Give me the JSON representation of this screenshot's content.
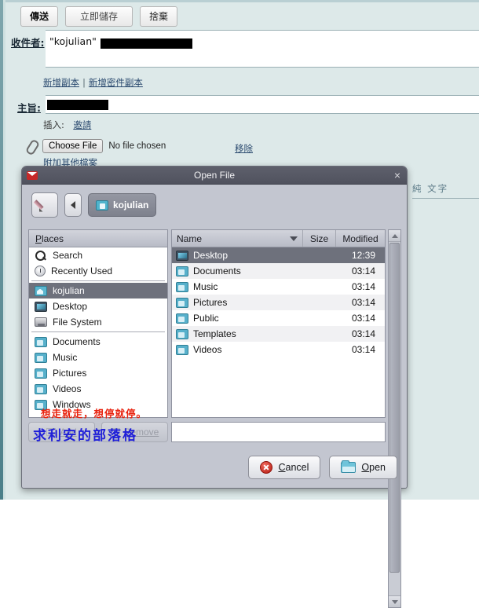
{
  "compose": {
    "toolbar": {
      "send_label": "傳送",
      "save_label": "立即儲存",
      "discard_label": "捨棄"
    },
    "to": {
      "label": "收件者:",
      "value": "\"kojulian\""
    },
    "cc_links": {
      "add_cc": "新增副本",
      "separator": "|",
      "add_bcc": "新增密件副本"
    },
    "subject": {
      "label": "主旨:",
      "value": ""
    },
    "insert": {
      "label": "插入:",
      "invite_link": "邀請"
    },
    "attachment": {
      "choose_button": "Choose File",
      "status": "No file chosen",
      "remove_link": "移除",
      "attach_more_link": "附加其他檔案"
    },
    "plain_text_link": "純 文字"
  },
  "dialog": {
    "title": "Open File",
    "close_label": "×",
    "nav": {
      "edit_icon": "pencil-icon",
      "back_icon": "triangle-left-icon",
      "path_button": "kojulian"
    },
    "places": {
      "header": "Places",
      "header_mnemonic": "P",
      "header_rest": "laces",
      "items": [
        {
          "label": "Search",
          "icon": "search-icon",
          "selected": false
        },
        {
          "label": "Recently Used",
          "icon": "clock-icon",
          "selected": false
        },
        {
          "label": "kojulian",
          "icon": "home-folder-icon",
          "selected": true
        },
        {
          "label": "Desktop",
          "icon": "monitor-icon",
          "selected": false
        },
        {
          "label": "File System",
          "icon": "disk-icon",
          "selected": false
        },
        {
          "label": "Documents",
          "icon": "folder-icon",
          "selected": false
        },
        {
          "label": "Music",
          "icon": "folder-icon",
          "selected": false
        },
        {
          "label": "Pictures",
          "icon": "folder-icon",
          "selected": false
        },
        {
          "label": "Videos",
          "icon": "folder-icon",
          "selected": false
        },
        {
          "label": "Windows",
          "icon": "folder-icon",
          "selected": false
        }
      ]
    },
    "filelist": {
      "columns": {
        "name": "Name",
        "size": "Size",
        "modified": "Modified"
      },
      "sort_indicator": "descending",
      "rows": [
        {
          "name": "Desktop",
          "size": "",
          "modified": "12:39",
          "icon": "monitor-icon",
          "selected": true
        },
        {
          "name": "Documents",
          "size": "",
          "modified": "03:14",
          "icon": "folder-icon",
          "selected": false
        },
        {
          "name": "Music",
          "size": "",
          "modified": "03:14",
          "icon": "folder-icon",
          "selected": false
        },
        {
          "name": "Pictures",
          "size": "",
          "modified": "03:14",
          "icon": "folder-icon",
          "selected": false
        },
        {
          "name": "Public",
          "size": "",
          "modified": "03:14",
          "icon": "folder-icon",
          "selected": false
        },
        {
          "name": "Templates",
          "size": "",
          "modified": "03:14",
          "icon": "folder-icon",
          "selected": false
        },
        {
          "name": "Videos",
          "size": "",
          "modified": "03:14",
          "icon": "folder-icon",
          "selected": false
        }
      ]
    },
    "side_buttons": {
      "add": "Add",
      "remove": "Remove"
    },
    "actions": {
      "cancel": "Cancel",
      "cancel_mnemonic": "C",
      "cancel_rest": "ancel",
      "open": "Open",
      "open_mnemonic": "O",
      "open_rest": "pen"
    }
  },
  "watermarks": {
    "red": "想走就走，想停就停。",
    "blue": "求利安的部落格"
  },
  "colors": {
    "page_background": "#dde9e9",
    "dialog_background": "#c3c6d0",
    "titlebar": "#555763",
    "selection": "#6e717c",
    "link": "#2b4a6f",
    "watermark_red": "#e8230f",
    "watermark_blue": "#1f1fd8"
  }
}
